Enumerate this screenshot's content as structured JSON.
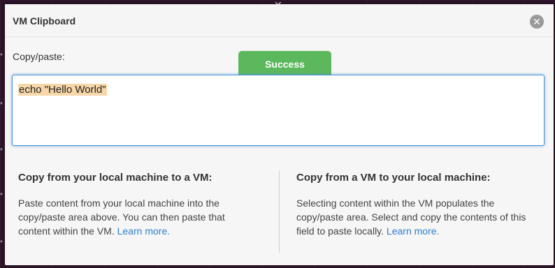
{
  "modal": {
    "title": "VM Clipboard",
    "close_icon": "close-icon",
    "field_label": "Copy/paste:",
    "toast_text": "Success",
    "clipboard_text": "echo \"Hello World\""
  },
  "sections": [
    {
      "heading": "Copy from your local machine to a VM:",
      "body": "Paste content from your local machine into the copy/paste area above. You can then paste that content within the VM. ",
      "link": "Learn more."
    },
    {
      "heading": "Copy from a VM to your local machine:",
      "body": "Selecting content within the VM populates the copy/paste area. Select and copy the contents of this field to paste locally. ",
      "link": "Learn more."
    }
  ],
  "colors": {
    "toast": "#5cb85c",
    "link": "#2a7fd0",
    "focus_border": "#4a90d9",
    "highlight": "#f7d6a8"
  }
}
